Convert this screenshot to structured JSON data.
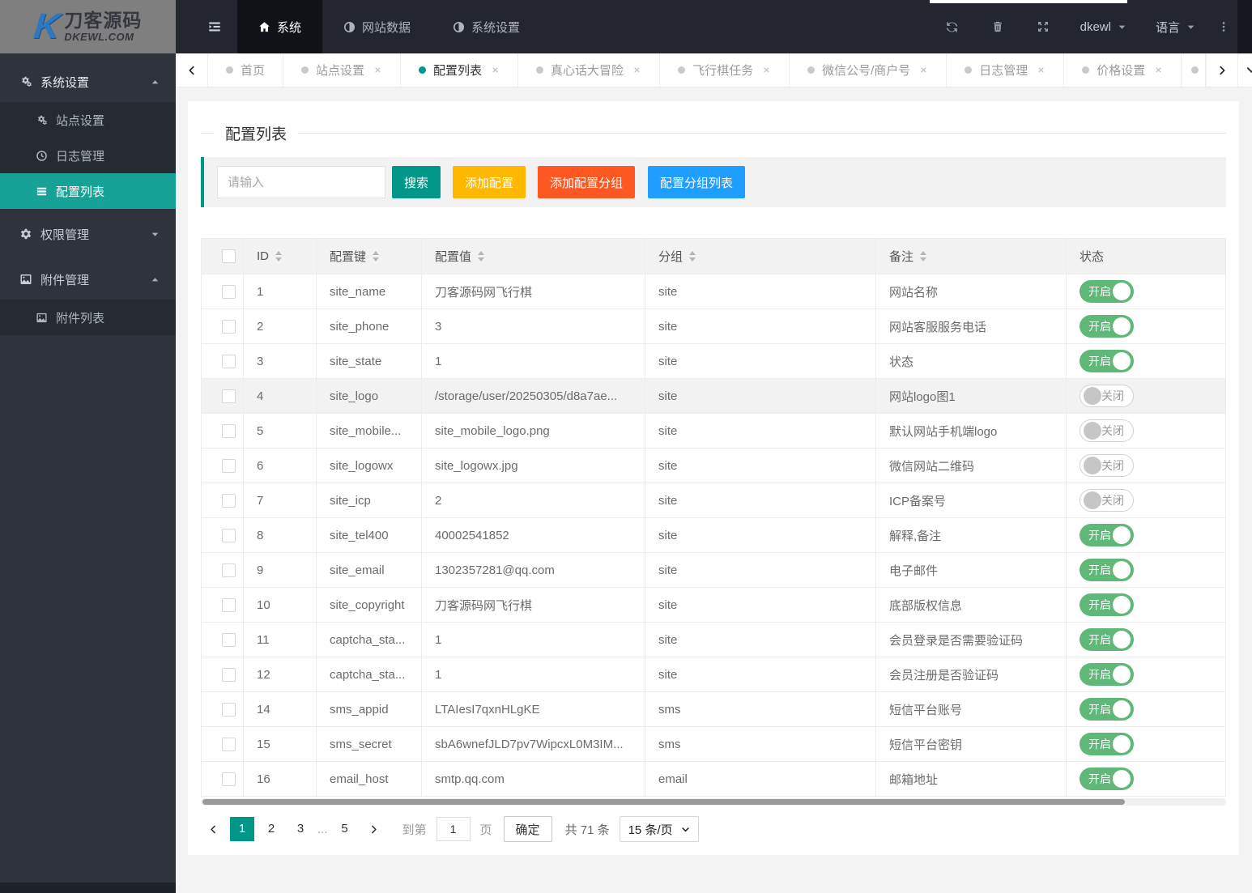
{
  "colors": {
    "accent_teal": "#009688",
    "sidebar_active": "#16a296",
    "switch_on_green": "#5fb878",
    "button_search": "#009688",
    "button_yellow": "#ffb800",
    "button_red": "#ff5722",
    "button_blue": "#1e9fff",
    "topbar_bg": "#23262e",
    "sidebar_bg": "#2f333b"
  },
  "header": {
    "logo": {
      "title": "刀客源码",
      "subtitle": "DKEWL.COM"
    },
    "nav": [
      {
        "label": "系统",
        "icon": "home-icon",
        "active": true
      },
      {
        "label": "网站数据",
        "icon": "adjust-icon",
        "active": false
      },
      {
        "label": "系统设置",
        "icon": "adjust-icon",
        "active": false
      }
    ],
    "actions": [
      "refresh-icon",
      "trash-icon",
      "fullscreen-icon",
      "kebab-menu-icon"
    ],
    "user": {
      "name": "dkewl"
    },
    "language": {
      "label": "语言"
    }
  },
  "tabs": {
    "items": [
      {
        "label": "首页",
        "closable": false,
        "active": false
      },
      {
        "label": "站点设置",
        "closable": true,
        "active": false
      },
      {
        "label": "配置列表",
        "closable": true,
        "active": true
      },
      {
        "label": "真心话大冒险",
        "closable": true,
        "active": false
      },
      {
        "label": "飞行棋任务",
        "closable": true,
        "active": false
      },
      {
        "label": "微信公号/商户号",
        "closable": true,
        "active": false
      },
      {
        "label": "日志管理",
        "closable": true,
        "active": false
      },
      {
        "label": "价格设置",
        "closable": true,
        "active": false
      }
    ]
  },
  "sidebar": {
    "groups": [
      {
        "label": "系统设置",
        "icon": "cogs-icon",
        "expanded": true,
        "items": [
          {
            "label": "站点设置",
            "icon": "cogs-icon",
            "active": false
          },
          {
            "label": "日志管理",
            "icon": "clock-icon",
            "active": false
          },
          {
            "label": "配置列表",
            "icon": "list-icon",
            "active": true
          }
        ]
      },
      {
        "label": "权限管理",
        "icon": "gear-icon",
        "expanded": false,
        "items": []
      },
      {
        "label": "附件管理",
        "icon": "image-icon",
        "expanded": true,
        "items": [
          {
            "label": "附件列表",
            "icon": "image-icon",
            "active": false
          }
        ]
      }
    ]
  },
  "main": {
    "title": "配置列表",
    "toolbar": {
      "placeholder": "请输入",
      "search": "搜索",
      "add_config": "添加配置",
      "add_group": "添加配置分组",
      "group_list": "配置分组列表"
    },
    "table": {
      "columns": [
        {
          "label": "ID",
          "sortable": true
        },
        {
          "label": "配置键",
          "sortable": true
        },
        {
          "label": "配置值",
          "sortable": true
        },
        {
          "label": "分组",
          "sortable": true
        },
        {
          "label": "备注",
          "sortable": true
        },
        {
          "label": "状态",
          "sortable": false
        }
      ],
      "rows": [
        {
          "id": "1",
          "key": "site_name",
          "value": "刀客源码网飞行棋",
          "group": "site",
          "remark": "网站名称",
          "status": "开启"
        },
        {
          "id": "2",
          "key": "site_phone",
          "value": "3",
          "group": "site",
          "remark": "网站客服服务电话",
          "status": "开启"
        },
        {
          "id": "3",
          "key": "site_state",
          "value": "1",
          "group": "site",
          "remark": "状态",
          "status": "开启"
        },
        {
          "id": "4",
          "key": "site_logo",
          "value": "/storage/user/20250305/d8a7ae...",
          "group": "site",
          "remark": "网站logo图1",
          "status": "关闭"
        },
        {
          "id": "5",
          "key": "site_mobile...",
          "value": "site_mobile_logo.png",
          "group": "site",
          "remark": "默认网站手机端logo",
          "status": "关闭"
        },
        {
          "id": "6",
          "key": "site_logowx",
          "value": "site_logowx.jpg",
          "group": "site",
          "remark": "微信网站二维码",
          "status": "关闭"
        },
        {
          "id": "7",
          "key": "site_icp",
          "value": "2",
          "group": "site",
          "remark": "ICP备案号",
          "status": "关闭"
        },
        {
          "id": "8",
          "key": "site_tel400",
          "value": "40002541852",
          "group": "site",
          "remark": "解释,备注",
          "status": "开启"
        },
        {
          "id": "9",
          "key": "site_email",
          "value": "1302357281@qq.com",
          "group": "site",
          "remark": "电子邮件",
          "status": "开启"
        },
        {
          "id": "10",
          "key": "site_copyright",
          "value": "刀客源码网飞行棋",
          "group": "site",
          "remark": "底部版权信息",
          "status": "开启"
        },
        {
          "id": "11",
          "key": "captcha_sta...",
          "value": "1",
          "group": "site",
          "remark": "会员登录是否需要验证码",
          "status": "开启"
        },
        {
          "id": "12",
          "key": "captcha_sta...",
          "value": "1",
          "group": "site",
          "remark": "会员注册是否验证码",
          "status": "开启"
        },
        {
          "id": "14",
          "key": "sms_appid",
          "value": "LTAIesI7qxnHLgKE",
          "group": "sms",
          "remark": "短信平台账号",
          "status": "开启"
        },
        {
          "id": "15",
          "key": "sms_secret",
          "value": "sbA6wnefJLD7pv7WipcxL0M3IM...",
          "group": "sms",
          "remark": "短信平台密钥",
          "status": "开启"
        },
        {
          "id": "16",
          "key": "email_host",
          "value": "smtp.qq.com",
          "group": "email",
          "remark": "邮箱地址",
          "status": "开启"
        }
      ]
    },
    "pagination": {
      "pages": [
        "1",
        "2",
        "3",
        "...",
        "5"
      ],
      "active_page": "1",
      "goto_label": "到第",
      "goto_value": "1",
      "goto_unit": "页",
      "confirm": "确定",
      "total": "共 71 条",
      "page_size": "15 条/页"
    }
  }
}
